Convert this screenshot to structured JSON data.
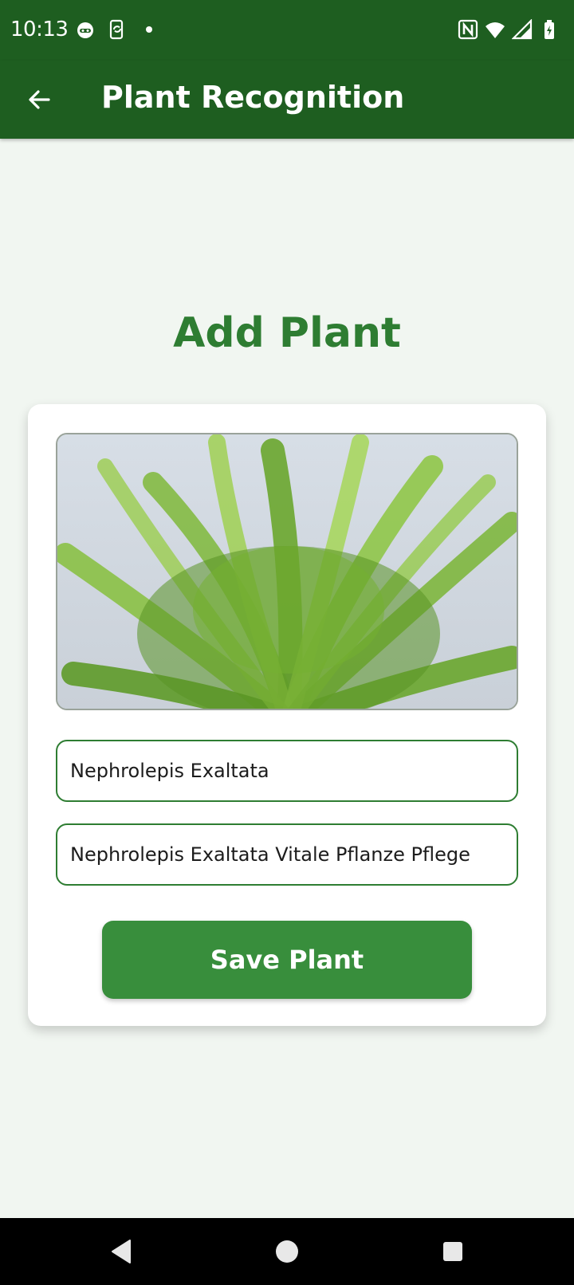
{
  "status_bar": {
    "time": "10:13",
    "left_icons": [
      "cat-face-icon",
      "phone-sync-icon",
      "dot-icon"
    ],
    "right_icons": [
      "nfc-icon",
      "wifi-icon",
      "signal-icon",
      "battery-icon"
    ]
  },
  "app_bar": {
    "title": "Plant Recognition",
    "back_icon": "arrow-left-icon",
    "color": "#1e5e20"
  },
  "page": {
    "heading": "Add Plant",
    "accent_color": "#2e7d32"
  },
  "form": {
    "image": "fern-plant-photo",
    "name_value": "Nephrolepis Exaltata",
    "description_value": "Nephrolepis Exaltata Vitale Pflanze Pflege",
    "save_label": "Save Plant",
    "button_color": "#388e3c"
  },
  "nav_bar": {
    "buttons": [
      "back-triangle-icon",
      "home-circle-icon",
      "recents-square-icon"
    ]
  }
}
